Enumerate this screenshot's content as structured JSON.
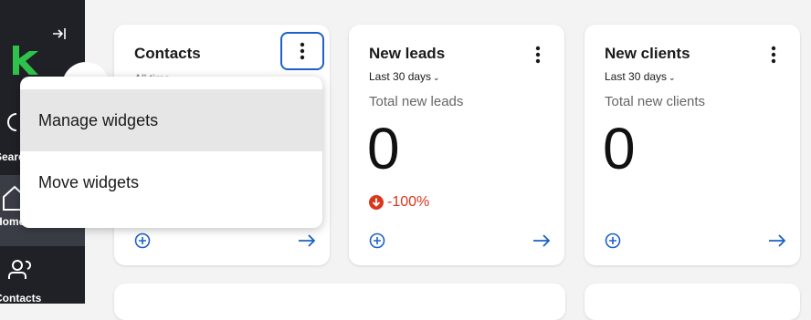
{
  "sidebar": {
    "items": [
      {
        "label": "Search"
      },
      {
        "label": "Home"
      },
      {
        "label": "Contacts"
      }
    ]
  },
  "cards": [
    {
      "title": "Contacts",
      "period": "All time",
      "description": "",
      "value": "",
      "change": ""
    },
    {
      "title": "New leads",
      "period": "Last 30 days",
      "description": "Total new leads",
      "value": "0",
      "change": "-100%"
    },
    {
      "title": "New clients",
      "period": "Last 30 days",
      "description": "Total new clients",
      "value": "0",
      "change": ""
    }
  ],
  "menu": {
    "items": [
      {
        "label": "Manage widgets"
      },
      {
        "label": "Move widgets"
      }
    ]
  },
  "colors": {
    "accent": "#1c61c8",
    "negative": "#d9371b",
    "brand": "#2fc24b",
    "sidebar": "#1f2126"
  }
}
